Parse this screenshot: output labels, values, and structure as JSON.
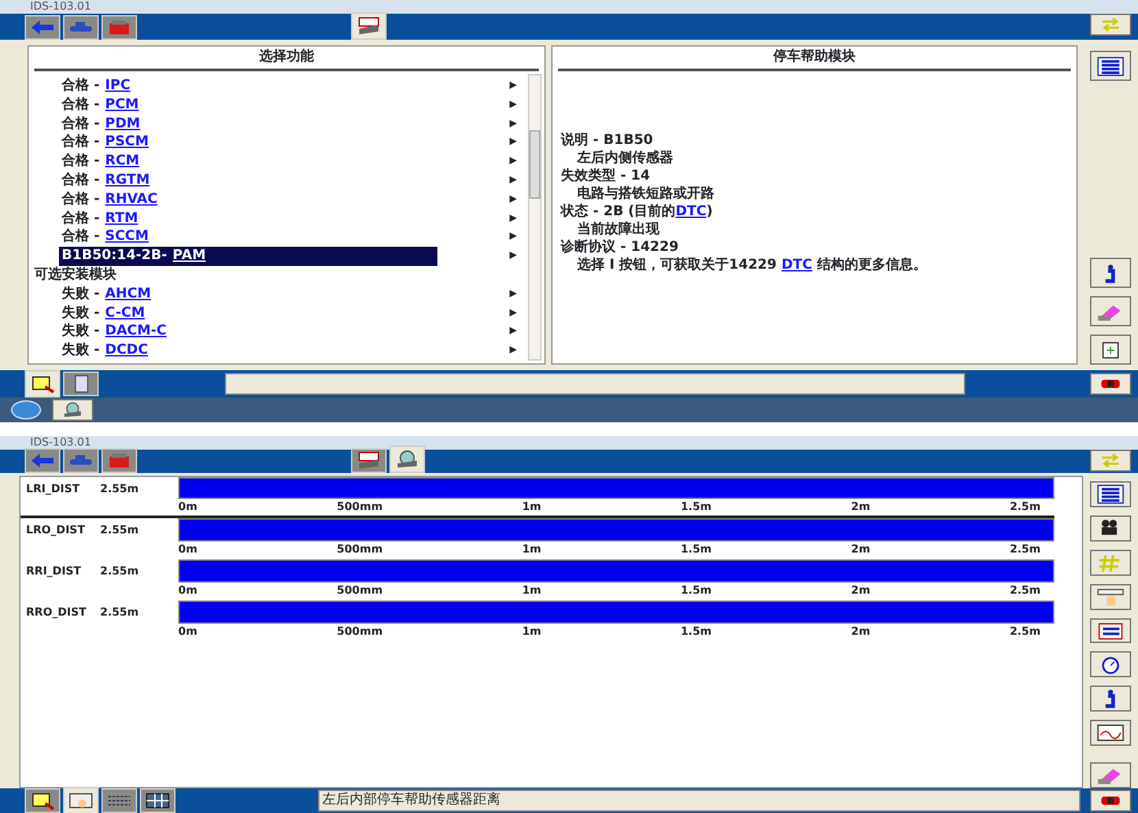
{
  "dtc_window": {
    "title": "IDS-103.01",
    "tabs": [
      {
        "kind": "back",
        "selected": false
      },
      {
        "kind": "vehicle",
        "selected": false
      },
      {
        "kind": "toolbox",
        "selected": false
      },
      {
        "kind": "dtc",
        "selected": true
      }
    ],
    "left_panel": {
      "heading": "选择功能",
      "items": [
        {
          "kind": "module",
          "status": "合格 -",
          "module": "IPC",
          "arrow": "▶",
          "selected": false
        },
        {
          "kind": "module",
          "status": "合格 -",
          "module": "PCM",
          "arrow": "▶",
          "selected": false
        },
        {
          "kind": "module",
          "status": "合格 -",
          "module": "PDM",
          "arrow": "▶",
          "selected": false
        },
        {
          "kind": "module",
          "status": "合格 -",
          "module": "PSCM",
          "arrow": "▶",
          "selected": false
        },
        {
          "kind": "module",
          "status": "合格 -",
          "module": "RCM",
          "arrow": "▶",
          "selected": false
        },
        {
          "kind": "module",
          "status": "合格 -",
          "module": "RGTM",
          "arrow": "▶",
          "selected": false
        },
        {
          "kind": "module",
          "status": "合格 -",
          "module": "RHVAC",
          "arrow": "▶",
          "selected": false
        },
        {
          "kind": "module",
          "status": "合格 -",
          "module": "RTM",
          "arrow": "▶",
          "selected": false
        },
        {
          "kind": "module",
          "status": "合格 -",
          "module": "SCCM",
          "arrow": "▶",
          "selected": false
        },
        {
          "kind": "dtc",
          "status": "B1B50:14-2B-",
          "module": "PAM",
          "arrow": "▶",
          "selected": true
        },
        {
          "kind": "header",
          "status": "可选安装模块"
        },
        {
          "kind": "module",
          "status": "失败 -",
          "module": "AHCM",
          "arrow": "▶",
          "selected": false
        },
        {
          "kind": "module",
          "status": "失败 -",
          "module": "C-CM",
          "arrow": "▶",
          "selected": false
        },
        {
          "kind": "module",
          "status": "失败 -",
          "module": "DACM-C",
          "arrow": "▶",
          "selected": false
        },
        {
          "kind": "module",
          "status": "失败 -",
          "module": "DCDC",
          "arrow": "▶",
          "selected": false
        }
      ]
    },
    "right_panel": {
      "heading": "停车帮助模块",
      "lines": [
        {
          "kind": "label",
          "text": "说明 - B1B50"
        },
        {
          "kind": "detail",
          "text": "左后内侧传感器"
        },
        {
          "kind": "label",
          "text": "失效类型 - 14"
        },
        {
          "kind": "detail",
          "text": "电路与搭铁短路或开路"
        },
        {
          "kind": "label",
          "text": "状态 - 2B (目前的",
          "link": "DTC",
          "after": ")"
        },
        {
          "kind": "detail",
          "text": "当前故障出现"
        },
        {
          "kind": "label",
          "text": "诊断协议 - 14229"
        },
        {
          "kind": "detail",
          "text": "选择 I 按钮，可获取关于14229 ",
          "link": "DTC",
          "after": " 结构的更多信息。"
        }
      ]
    },
    "bottom_tabs": [
      {
        "kind": "network",
        "selected": true
      },
      {
        "kind": "document",
        "selected": false
      }
    ]
  },
  "datalogger_window": {
    "title": "IDS-103.01",
    "tabs": [
      {
        "kind": "back",
        "selected": false
      },
      {
        "kind": "vehicle",
        "selected": false
      },
      {
        "kind": "toolbox",
        "selected": false
      },
      {
        "kind": "dtc",
        "selected": false
      },
      {
        "kind": "datalogger",
        "selected": true
      }
    ],
    "sensors": [
      {
        "name": "LRI_DIST",
        "reading": "2.55m",
        "level": 1,
        "ticks": [
          "0m",
          "500mm",
          "1m",
          "1.5m",
          "2m",
          "2.5m"
        ]
      },
      {
        "name": "LRO_DIST",
        "reading": "2.55m",
        "level": 1,
        "ticks": [
          "0m",
          "500mm",
          "1m",
          "1.5m",
          "2m",
          "2.5m"
        ]
      },
      {
        "name": "RRI_DIST",
        "reading": "2.55m",
        "level": 1,
        "ticks": [
          "0m",
          "500mm",
          "1m",
          "1.5m",
          "2m",
          "2.5m"
        ]
      },
      {
        "name": "RRO_DIST",
        "reading": "2.55m",
        "level": 1,
        "ticks": [
          "0m",
          "500mm",
          "1m",
          "1.5m",
          "2m",
          "2.5m"
        ]
      }
    ],
    "bottom_tabs": [
      {
        "kind": "network",
        "selected": false
      },
      {
        "kind": "grid",
        "selected": true
      },
      {
        "kind": "wave",
        "selected": false
      },
      {
        "kind": "table",
        "selected": false
      }
    ],
    "status_text": "左后内部停车帮助传感器距离"
  }
}
